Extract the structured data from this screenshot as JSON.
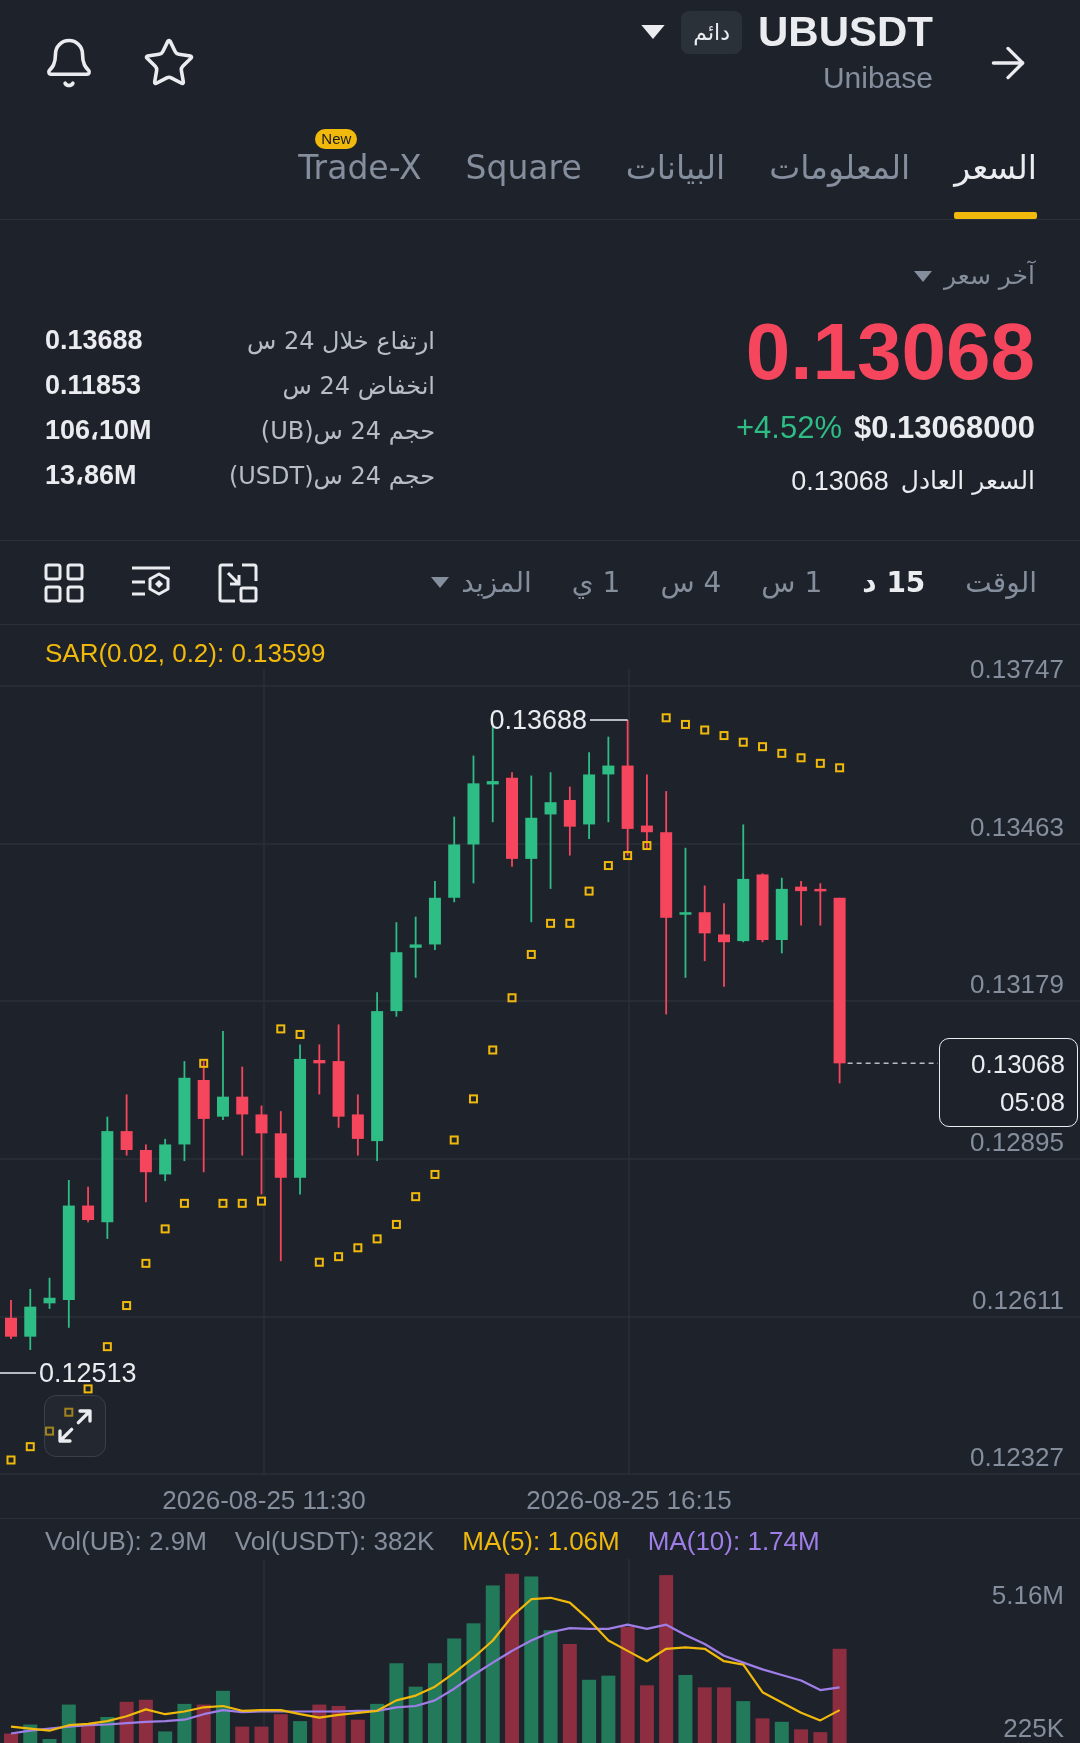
{
  "header": {
    "symbol": "UBUSDT",
    "contract_type": "دائم",
    "name": "Unibase"
  },
  "tabs": [
    {
      "label": "السعر",
      "selected": true
    },
    {
      "label": "المعلومات",
      "selected": false
    },
    {
      "label": "البيانات",
      "selected": false
    },
    {
      "label": "Square",
      "selected": false
    },
    {
      "label": "Trade-X",
      "selected": false,
      "badge": "New"
    }
  ],
  "price_panel": {
    "price_type": "آخر سعر",
    "last_price": "0.13068",
    "last_price_down": true,
    "usd_price": "$0.13068000",
    "change": "+4.52%",
    "change_up": true,
    "fair_price_label": "السعر العادل",
    "fair_price": "0.13068"
  },
  "stats": [
    {
      "label": "ارتفاع خلال 24 س",
      "value": "0.13688"
    },
    {
      "label": "انخفاض 24 س",
      "value": "0.11853"
    },
    {
      "label": "حجم 24 س(UB)",
      "value": "106،10M"
    },
    {
      "label": "حجم 24 س(USDT)",
      "value": "13،86M"
    }
  ],
  "chart_toolbar": {
    "time_label": "الوقت",
    "intervals": [
      {
        "label": "15 د",
        "selected": true
      },
      {
        "label": "1 س",
        "selected": false
      },
      {
        "label": "4 س",
        "selected": false
      },
      {
        "label": "1 ي",
        "selected": false
      }
    ],
    "more": "المزيد"
  },
  "chart": {
    "indicator": "SAR(0.02, 0.2): 0.13599",
    "price_axis": [
      "0.13747",
      "0.13463",
      "0.13179",
      "0.12895",
      "0.12611",
      "0.12327"
    ],
    "high_label": "0.13688",
    "low_label": "0.12513",
    "last_price_tag": {
      "price": "0.13068",
      "countdown": "05:08"
    },
    "time_axis": [
      "2026-08-25 16:15",
      "2026-08-25 11:30"
    ]
  },
  "volume": {
    "legend": [
      {
        "kind": "ma",
        "text": "MA(10): 1.74M",
        "color": "#9f7ee8"
      },
      {
        "kind": "ma",
        "text": "MA(5): 1.06M",
        "color": "#f0b90b"
      },
      {
        "kind": "volume",
        "text": "Vol(USDT): 382K",
        "color": "#848e9c"
      },
      {
        "kind": "volume",
        "text": "Vol(UB): 2.9M",
        "color": "#848e9c"
      }
    ],
    "axis": [
      "5.16M",
      "225K"
    ]
  }
}
